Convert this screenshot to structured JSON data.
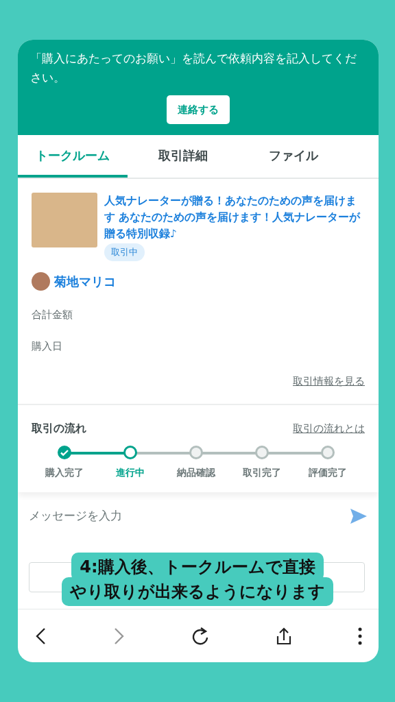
{
  "notice": {
    "text": "「購入にあたってのお願い」を読んで依頼内容を記入してください。",
    "button": "連絡する"
  },
  "tabs": [
    {
      "label": "トークルーム",
      "selected": true
    },
    {
      "label": "取引詳細",
      "selected": false
    },
    {
      "label": "ファイル",
      "selected": false
    }
  ],
  "product": {
    "title": "人気ナレーターが贈る！あなたのための声を届けます あなたのための声を届けます！人気ナレーターが贈る特別収録♪",
    "status_badge": "取引中",
    "seller": "菊地マリコ",
    "fields": [
      "合計金額",
      "購入日"
    ],
    "link": "取引情報を見る"
  },
  "flow": {
    "title": "取引の流れ",
    "link": "取引の流れとは",
    "steps": [
      {
        "label": "購入完了",
        "kind": "done"
      },
      {
        "label": "進行中",
        "kind": "current"
      },
      {
        "label": "納品確認",
        "kind": "pending"
      },
      {
        "label": "取引完了",
        "kind": "pending"
      },
      {
        "label": "評価完了",
        "kind": "pending"
      }
    ]
  },
  "message": {
    "placeholder": "メッセージを入力"
  },
  "caption": [
    "4:購入後、トークルームで直接",
    "やり取りが出来るようになります"
  ]
}
